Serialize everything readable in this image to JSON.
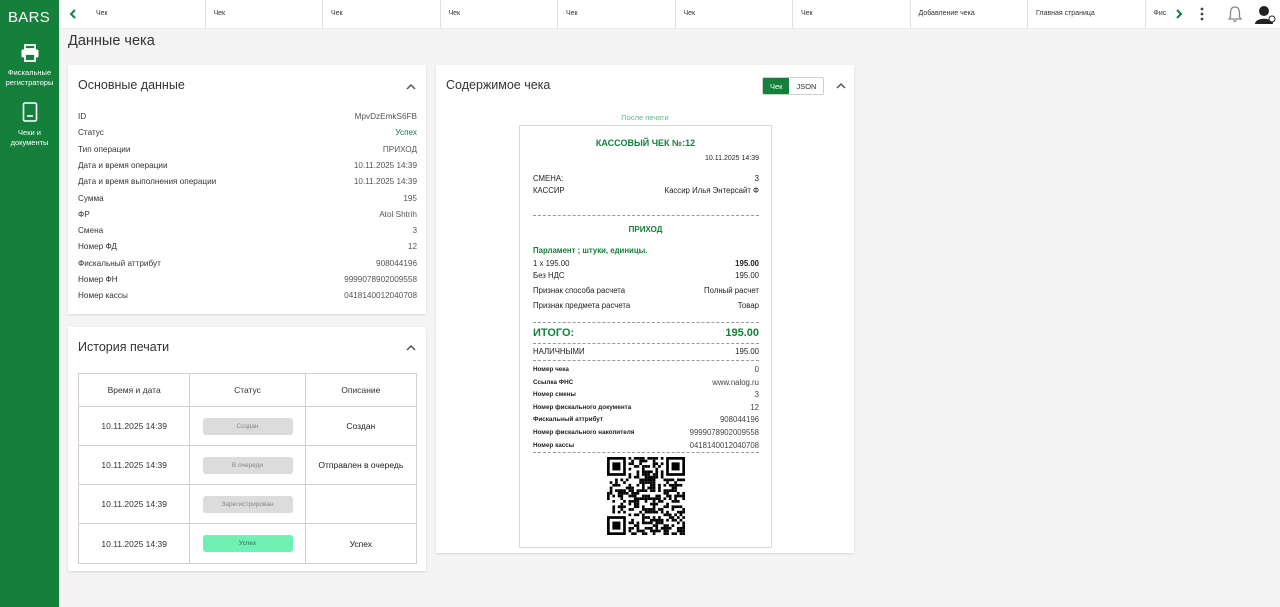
{
  "brand": "BARS",
  "sidebar": {
    "items": [
      {
        "label": "Фискальные регистраторы",
        "icon": "printer-icon"
      },
      {
        "label": "Чеки и документы",
        "icon": "document-icon"
      }
    ]
  },
  "tabs": [
    "Чек",
    "Чек",
    "Чек",
    "Чек",
    "Чек",
    "Чек",
    "Чек",
    "Добавление чека",
    "Главная страница",
    "Фис"
  ],
  "page_title": "Данные чека",
  "main_data": {
    "title": "Основные данные",
    "rows": [
      {
        "key": "ID",
        "value": "MpvDzEmkS6FB"
      },
      {
        "key": "Статус",
        "value": "Успех"
      },
      {
        "key": "Тип операции",
        "value": "ПРИХОД"
      },
      {
        "key": "Дата и время операции",
        "value": "10.11.2025 14:39"
      },
      {
        "key": "Дата и время выполнения операции",
        "value": "10.11.2025 14:39"
      },
      {
        "key": "Сумма",
        "value": "195"
      },
      {
        "key": "ФР",
        "value": "Atol Shtrih"
      },
      {
        "key": "Смена",
        "value": "3"
      },
      {
        "key": "Номер ФД",
        "value": "12"
      },
      {
        "key": "Фискальный аттрибут",
        "value": "908044196"
      },
      {
        "key": "Номер ФН",
        "value": "9999078902009558"
      },
      {
        "key": "Номер кассы",
        "value": "0418140012040708"
      }
    ]
  },
  "history": {
    "title": "История печати",
    "columns": [
      "Время и дата",
      "Статус",
      "Описание"
    ],
    "rows": [
      {
        "time": "10.11.2025 14:39",
        "status": "Создан",
        "description": "Создан"
      },
      {
        "time": "10.11.2025 14:39",
        "status": "В очереди",
        "description": "Отправлен в очередь"
      },
      {
        "time": "10.11.2025 14:39",
        "status": "Зарегистрирован",
        "description": ""
      },
      {
        "time": "10.11.2025 14:39",
        "status": "Успех",
        "description": "Успех"
      }
    ]
  },
  "receipt_panel": {
    "title": "Содержимое чека",
    "toggle": {
      "receipt": "Чек",
      "json": "JSON",
      "active": "receipt"
    },
    "caption": "После печати"
  },
  "receipt": {
    "title": "КАССОВЫЙ ЧЕК №:12",
    "datetime": "10.11.2025 14:39",
    "shift_label": "СМЕНА:",
    "shift_value": "3",
    "cashier_label": "КАССИР",
    "cashier_value": "Кассир Илья Энтерсайт Ф",
    "operation": "ПРИХОД",
    "item_name": "Парламент ; штуки, единицы.",
    "item_qty": "1 x 195.00",
    "item_sum": "195.00",
    "vat_label": "Без НДС",
    "vat_value": "195.00",
    "pay_method_label": "Признак способа расчета",
    "pay_method_value": "Полный расчет",
    "subject_label": "Признак предмета расчета",
    "subject_value": "Товар",
    "total_label": "ИТОГО:",
    "total_value": "195.00",
    "cash_label": "НАЛИЧНЫМИ",
    "cash_value": "195.00",
    "footer": [
      {
        "label": "Номер чека",
        "value": "0"
      },
      {
        "label": "Ссылка ФНС",
        "value": "www.nalog.ru"
      },
      {
        "label": "Номер смены",
        "value": "3"
      },
      {
        "label": "Номер фискального документа",
        "value": "12"
      },
      {
        "label": "Фискальный аттрибут",
        "value": "908044196"
      },
      {
        "label": "Номер фискального накопителя",
        "value": "9999078902009558"
      },
      {
        "label": "Номер кассы",
        "value": "0418140012040708"
      }
    ]
  },
  "colors": {
    "brand_green": "#14803c",
    "success_pill": "#6ff0b4",
    "neutral_pill": "#dcdcdc"
  }
}
